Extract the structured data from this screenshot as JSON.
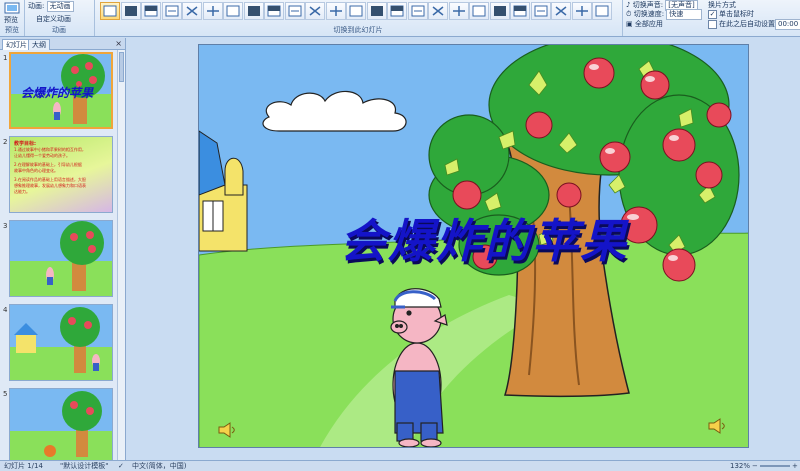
{
  "ribbon": {
    "preview_label": "预览",
    "preview_group": "预览",
    "anim_label": "动画:",
    "anim_value": "无动画",
    "custom_anim": "自定义动画",
    "anim_group": "动画",
    "transition_group": "切换到此幻灯片",
    "sound_label": "切换声音:",
    "sound_value": "[无声音]",
    "speed_label": "切换速度:",
    "speed_value": "快速",
    "apply_all": "全部应用",
    "advance_header": "换片方式",
    "on_click": "单击鼠标时",
    "after_time": "在此之后自动设置动画效果:",
    "after_time_value": "00:00"
  },
  "panel": {
    "tab_slides": "幻灯片",
    "tab_outline": "大纲",
    "close": "×",
    "slide_numbers": [
      "1",
      "2",
      "3",
      "4",
      "5"
    ],
    "thumb1_title": "会爆炸的苹果",
    "thumb2_title": "教学目标:",
    "thumb2_lines": [
      "1.通过故事中小猪和苹果树的相互作用，",
      "让幼儿懂得一个爱劳动的孩子。",
      "2.在理解故事的基础上，引导幼儿根据",
      "故事中角色的心理变化。",
      "3.在阅读作品的基础上用语言描述，大胆",
      "想象推理故事，发展幼儿想象力和口语表",
      "达能力。"
    ]
  },
  "slide": {
    "title": "会爆炸的苹果"
  },
  "status": {
    "slide_info": "幻灯片 1/14",
    "theme": "\"默认设计模板\"",
    "language": "中文(简体，中国)",
    "zoom": "132%"
  },
  "colors": {
    "sky": "#7ab9f2",
    "grass": "#8ae05a",
    "title": "#1414c8",
    "trunk": "#d28a3e",
    "apple": "#e84a5a",
    "leaf": "#2fa83a",
    "selection": "#f0a53a"
  },
  "icons": [
    "preview-icon",
    "speaker-icon",
    "transition-icon",
    "sound-icon",
    "speed-icon",
    "apply-all-icon"
  ]
}
